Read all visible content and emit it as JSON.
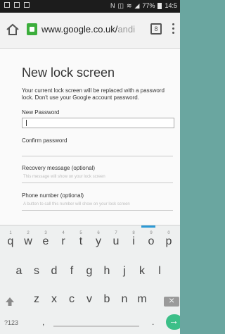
{
  "status_bar": {
    "signal_text": "N",
    "battery": "77%",
    "time": "14:5"
  },
  "address_bar": {
    "url_main": "www.google.co.uk/",
    "url_dim": "andi",
    "tabs_count": "8"
  },
  "page": {
    "title": "New lock screen",
    "description": "Your current lock screen will be replaced with a password lock. Don't use your Google account password.",
    "new_password_label": "New Password",
    "confirm_password_label": "Confirm password",
    "recovery_label": "Recovery message (optional)",
    "recovery_placeholder": "This message will show on your lock screen",
    "phone_label": "Phone number (optional)",
    "phone_placeholder": "A button to call this number will show on your lock screen"
  },
  "keyboard": {
    "row1": [
      "q",
      "w",
      "e",
      "r",
      "t",
      "y",
      "u",
      "i",
      "o",
      "p"
    ],
    "row1_nums": [
      "1",
      "2",
      "3",
      "4",
      "5",
      "6",
      "7",
      "8",
      "9",
      "0"
    ],
    "row2": [
      "a",
      "s",
      "d",
      "f",
      "g",
      "h",
      "j",
      "k",
      "l"
    ],
    "row3": [
      "z",
      "x",
      "c",
      "v",
      "b",
      "n",
      "m"
    ],
    "sym_label": "?123",
    "comma": ",",
    "period": "."
  }
}
